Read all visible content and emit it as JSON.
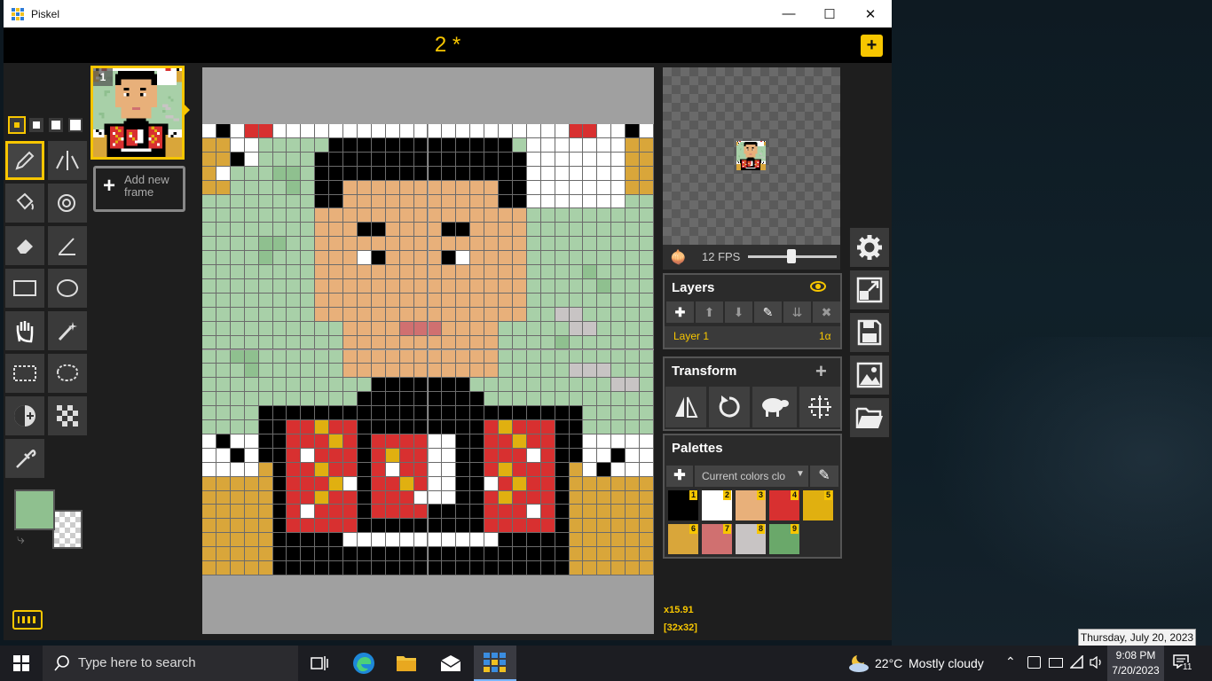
{
  "window": {
    "title": "Piskel",
    "minimize": "—",
    "maximize": "☐",
    "close": "✕"
  },
  "header": {
    "document_name": "2 *",
    "new_button": "+"
  },
  "frames": {
    "frame_number": "1",
    "add_frame_label": "Add new frame"
  },
  "preview": {
    "fps_label": "12 FPS",
    "fps": 12
  },
  "layers": {
    "title": "Layers",
    "layer_name": "Layer 1",
    "layer_alpha": "1α"
  },
  "transform": {
    "title": "Transform",
    "add": "+"
  },
  "palettes": {
    "title": "Palettes",
    "selected": "Current colors clo",
    "colors": [
      {
        "n": "1",
        "hex": "#000000"
      },
      {
        "n": "2",
        "hex": "#ffffff"
      },
      {
        "n": "3",
        "hex": "#e8b07a"
      },
      {
        "n": "4",
        "hex": "#d83030"
      },
      {
        "n": "5",
        "hex": "#e0b010"
      },
      {
        "n": "6",
        "hex": "#d9a63a"
      },
      {
        "n": "7",
        "hex": "#d07070"
      },
      {
        "n": "8",
        "hex": "#c8c4c4"
      },
      {
        "n": "9",
        "hex": "#6aa86a"
      }
    ]
  },
  "status": {
    "zoom": "x15.91",
    "size": "[32x32]"
  },
  "colors": {
    "primary": "#8fc08f",
    "accent": "#f7c600"
  },
  "taskbar": {
    "search_placeholder": "Type here to search",
    "weather_temp": "22°C",
    "weather_text": "Mostly cloudy",
    "time": "9:08 PM",
    "date": "7/20/2023",
    "notifications": "11",
    "tooltip": "Thursday, July 20, 2023"
  }
}
